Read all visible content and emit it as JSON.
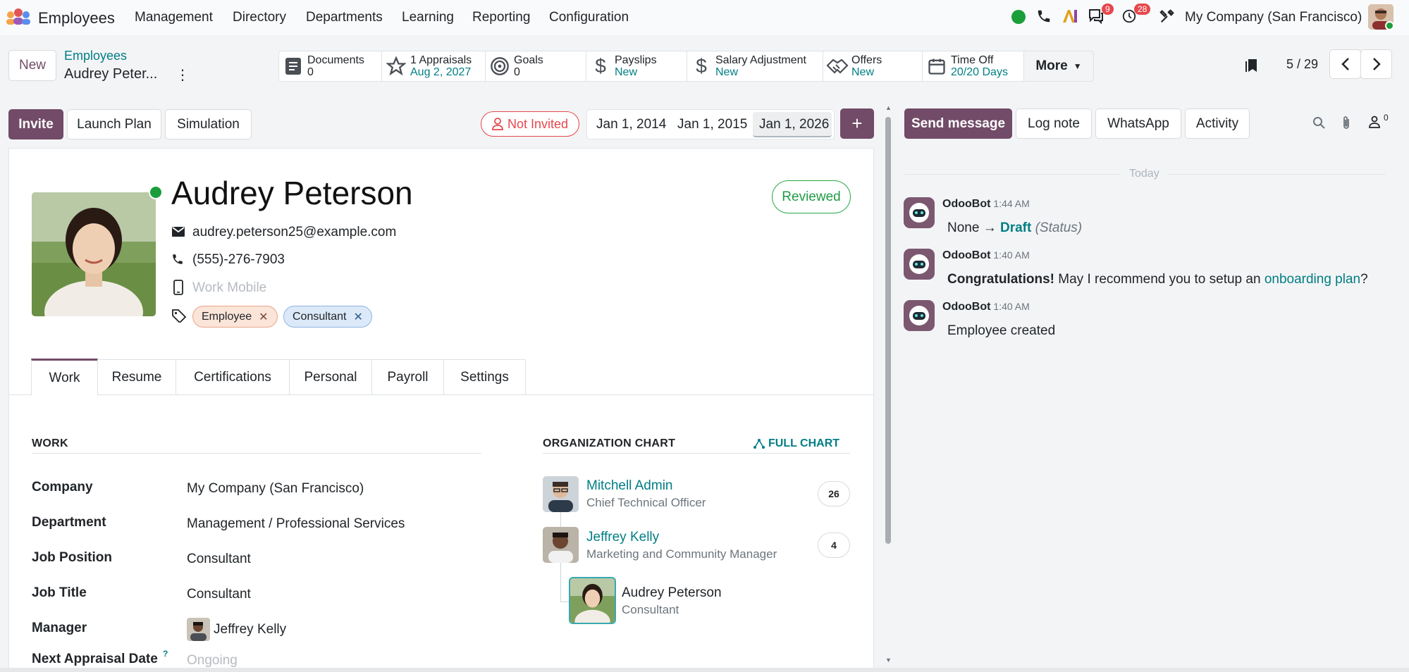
{
  "topnav": {
    "app_name": "Employees",
    "menu": [
      "Management",
      "Directory",
      "Departments",
      "Learning",
      "Reporting",
      "Configuration"
    ],
    "messages_badge": "9",
    "activities_badge": "28",
    "company": "My Company (San Francisco)"
  },
  "breadcrumb": {
    "parent": "Employees",
    "current": "Audrey Peter..."
  },
  "new_label": "New",
  "smart_buttons": [
    {
      "title": "Documents",
      "sub": "0"
    },
    {
      "title": "1 Appraisals",
      "sub": "Aug 2, 2027"
    },
    {
      "title": "Goals",
      "sub": "0"
    },
    {
      "title": "Payslips",
      "sub": "New"
    },
    {
      "title": "Salary Adjustment",
      "sub": "New"
    },
    {
      "title": "Offers",
      "sub": "New"
    },
    {
      "title": "Time Off",
      "sub": "20/20 Days"
    }
  ],
  "more_label": "More",
  "pager": "5 / 29",
  "actions": {
    "invite": "Invite",
    "launch_plan": "Launch Plan",
    "simulation": "Simulation",
    "not_invited": "Not Invited"
  },
  "dates": [
    "Jan 1, 2014",
    "Jan 1, 2015",
    "Jan 1, 2026"
  ],
  "plus": "+",
  "chatter_buttons": {
    "send": "Send message",
    "log": "Log note",
    "whatsapp": "WhatsApp",
    "activity": "Activity",
    "followers": "0"
  },
  "employee": {
    "name": "Audrey Peterson",
    "email": "audrey.peterson25@example.com",
    "phone": "(555)-276-7903",
    "mobile_placeholder": "Work Mobile",
    "status": "Reviewed",
    "tags": [
      "Employee",
      "Consultant"
    ]
  },
  "tabs": [
    "Work",
    "Resume",
    "Certifications",
    "Personal",
    "Payroll",
    "Settings"
  ],
  "work": {
    "heading": "WORK",
    "fields": [
      {
        "label": "Company",
        "value": "My Company (San Francisco)"
      },
      {
        "label": "Department",
        "value": "Management / Professional Services"
      },
      {
        "label": "Job Position",
        "value": "Consultant"
      },
      {
        "label": "Job Title",
        "value": "Consultant"
      },
      {
        "label": "Manager",
        "value": "Jeffrey Kelly"
      },
      {
        "label": "Next Appraisal Date",
        "value": "Ongoing"
      }
    ],
    "help_mark": "?"
  },
  "org_chart": {
    "heading": "ORGANIZATION CHART",
    "full_chart": "FULL CHART",
    "people": [
      {
        "name": "Mitchell Admin",
        "job": "Chief Technical Officer",
        "count": "26"
      },
      {
        "name": "Jeffrey Kelly",
        "job": "Marketing and Community Manager",
        "count": "4"
      },
      {
        "name": "Audrey Peterson",
        "job": "Consultant"
      }
    ]
  },
  "chatter": {
    "day": "Today",
    "messages": [
      {
        "author": "OdooBot",
        "time": "1:44 AM",
        "pre": "None → ",
        "bold": "Draft",
        "post": " (Status)"
      },
      {
        "author": "OdooBot",
        "time": "1:40 AM",
        "bold": "Congratulations!",
        "text": " May I recommend you to setup an ",
        "link": "onboarding plan",
        "end": "?"
      },
      {
        "author": "OdooBot",
        "time": "1:40 AM",
        "text": "Employee created"
      }
    ]
  },
  "colors": {
    "brand": "#714b67",
    "link": "#017e84",
    "online": "#1a9e3a"
  }
}
